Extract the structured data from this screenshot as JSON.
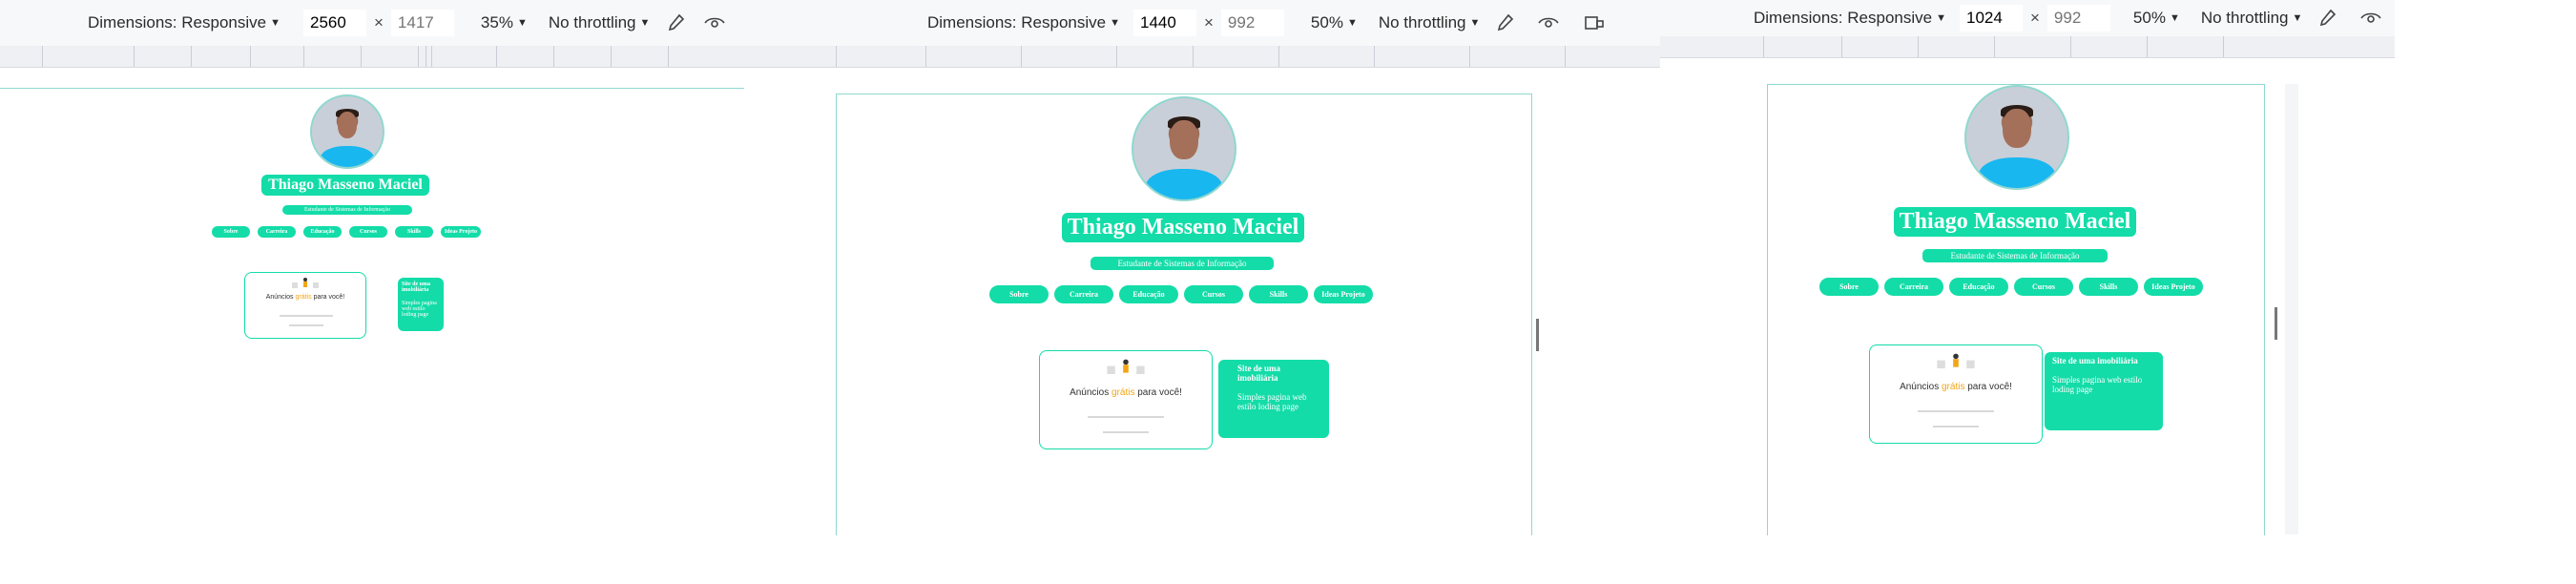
{
  "toolbar": {
    "dimensions_label": "Dimensions: Responsive",
    "times": "×",
    "throttling_label": "No throttling"
  },
  "views": [
    {
      "width": "2560",
      "height": "1417",
      "zoom": "35%"
    },
    {
      "width": "1440",
      "height": "992",
      "zoom": "50%"
    },
    {
      "width": "1024",
      "height": "992",
      "zoom": "50%"
    }
  ],
  "profile": {
    "name": "Thiago Masseno Maciel",
    "subtitle": "Estudante de Sistemas de Informação",
    "nav": [
      "Sobre",
      "Carreira",
      "Educação",
      "Cursos",
      "Skills",
      "Ideas Projeto"
    ]
  },
  "project": {
    "headline_start": "Anúncios",
    "headline_highlight": "grátis",
    "headline_end": "para você!",
    "title": "Site de uma imobiliária",
    "description": "Simples pagina web estilo loding page"
  },
  "colors": {
    "accent": "#13dca8",
    "frame": "#8fd8cf"
  }
}
